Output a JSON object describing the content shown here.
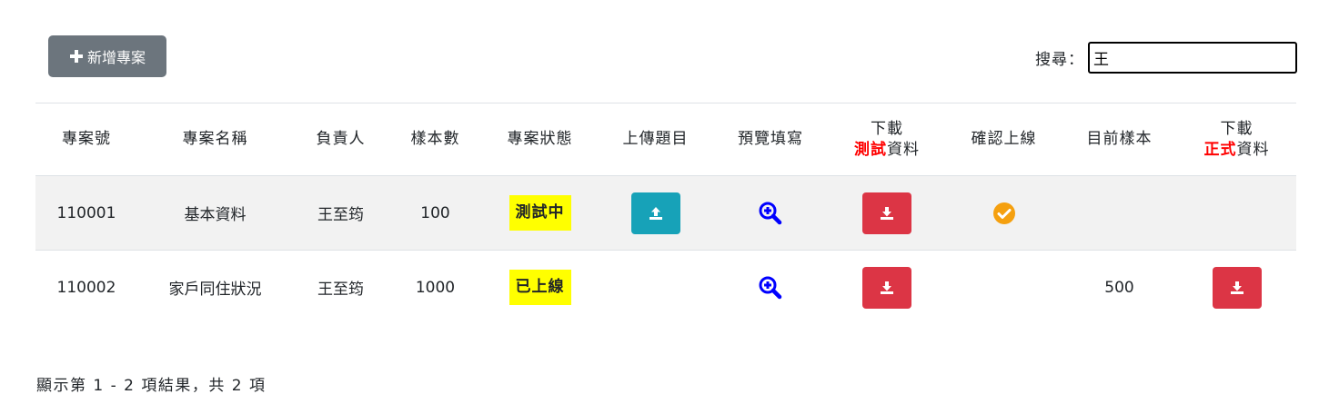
{
  "toolbar": {
    "add_label": "新增專案",
    "search_label": "搜尋：",
    "search_value": "王"
  },
  "table": {
    "headers": {
      "project_no": "專案號",
      "project_name": "專案名稱",
      "owner": "負責人",
      "sample_count": "樣本數",
      "status": "專案狀態",
      "upload": "上傳題目",
      "preview": "預覽填寫",
      "download_test_line1": "下載",
      "download_test_red": "測試",
      "download_test_rest": "資料",
      "confirm_online": "確認上線",
      "current_samples": "目前樣本",
      "download_formal_line1": "下載",
      "download_formal_red": "正式",
      "download_formal_rest": "資料"
    },
    "rows": [
      {
        "project_no": "110001",
        "project_name": "基本資料",
        "owner": "王至筠",
        "sample_count": "100",
        "status": "測試中",
        "current_samples": ""
      },
      {
        "project_no": "110002",
        "project_name": "家戶同住狀況",
        "owner": "王至筠",
        "sample_count": "1000",
        "status": "已上線",
        "current_samples": "500"
      }
    ]
  },
  "footer": {
    "info": "顯示第 1 - 2 項結果，共 2 項"
  },
  "icons": {
    "add": "plus-icon",
    "upload": "upload-icon",
    "preview": "zoom-in-icon",
    "download": "download-icon",
    "confirm": "check-circle-icon"
  },
  "colors": {
    "add_button": "#6c757d",
    "upload_button": "#17a2b8",
    "download_button": "#dc3545",
    "preview_icon": "#0000ff",
    "confirm_icon": "#f5a00f",
    "status_highlight": "#ffff00",
    "header_emphasis": "#ff0000"
  }
}
